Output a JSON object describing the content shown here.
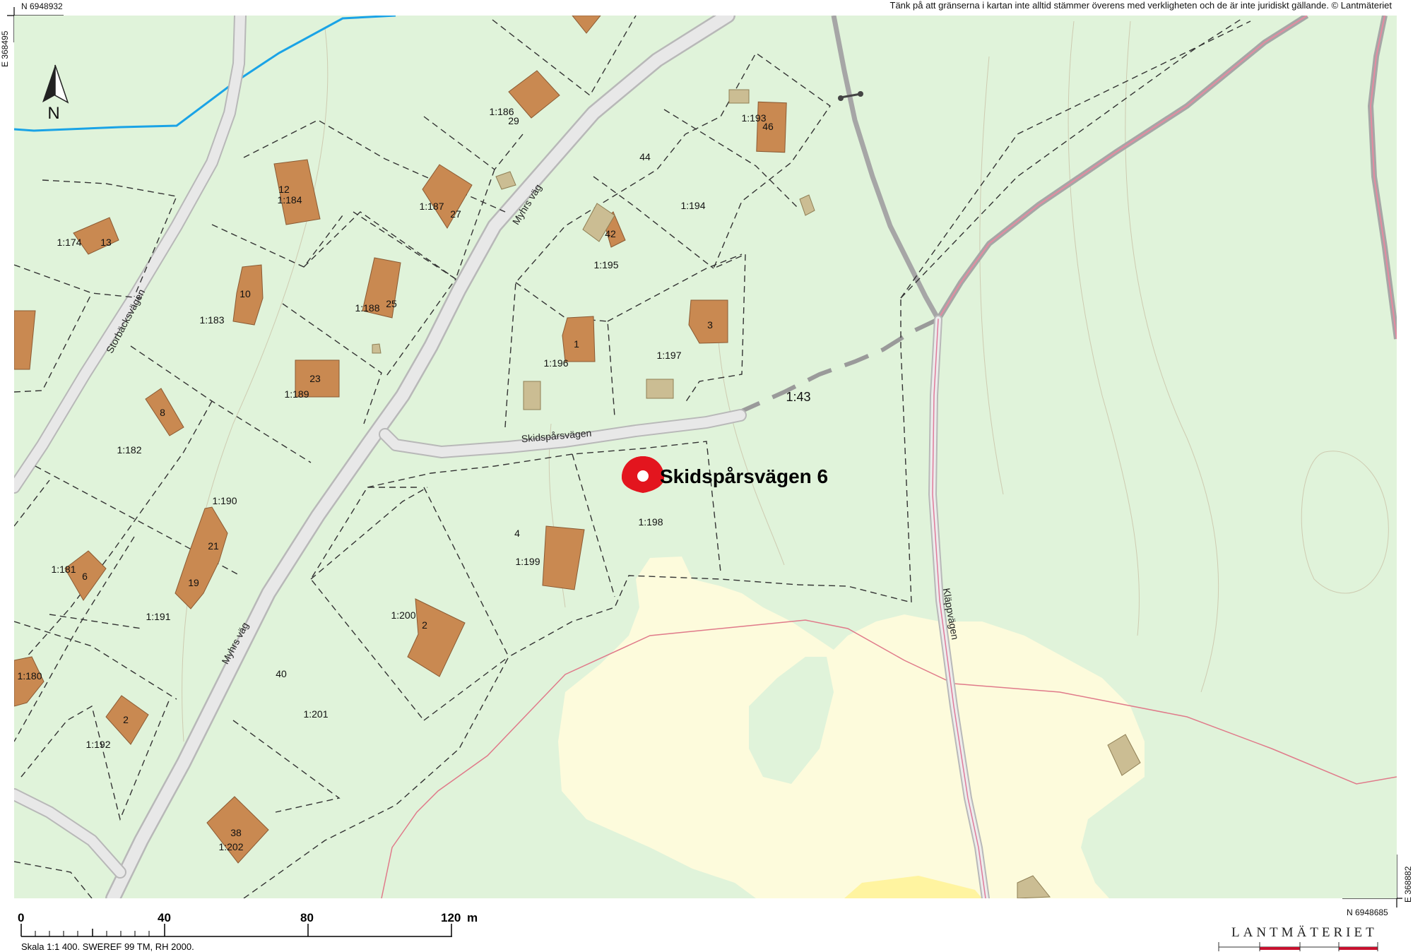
{
  "disclaimer": "Tänk på att gränserna i kartan inte alltid stämmer överens med verkligheten och de är inte juridiskt gällande. © Lantmäteriet",
  "coords": {
    "north_top": "N 6948932",
    "east_left": "E 368495",
    "north_bottom": "N 6948685",
    "east_right": "E 368882"
  },
  "marker": {
    "label": "Skidspårsvägen 6",
    "color": "#e3151e"
  },
  "north_arrow": "N",
  "roads": {
    "storback": "Storbäcksvägen",
    "myhrs_upper": "Myhrs väg",
    "myhrs_lower": "Myhrs väg",
    "skidspar": "Skidspårsvägen",
    "klapp": "Kläppvägen"
  },
  "parcel_labels": [
    "1:186",
    "29",
    "1:193",
    "46",
    "44",
    "12",
    "1:184",
    "1:187",
    "27",
    "1:194",
    "1:174",
    "13",
    "42",
    "1:195",
    "10",
    "1:183",
    "1:188",
    "25",
    "3",
    "1",
    "1:197",
    "1:196",
    "23",
    "1:189",
    "8",
    "1:43",
    "1:182",
    "1:198",
    "1:190",
    "4",
    "21",
    "1:199",
    "1:181",
    "6",
    "19",
    "1:200",
    "2",
    "1:191",
    "1:180",
    "40",
    "2",
    "1:201",
    "1:192",
    "38",
    "1:202"
  ],
  "scale": {
    "ticks": [
      "0",
      "40",
      "80",
      "120"
    ],
    "unit": "m",
    "note": "Skala 1:1 400. SWEREF 99 TM, RH 2000."
  },
  "brand": "LANTMÄTERIET",
  "colors": {
    "land": "#e0f3da",
    "open_land": "#fdfbdc",
    "building": "#c98951",
    "building_outline": "#8a5a33",
    "minor_building": "#cbbd93",
    "road_fill": "#e8e8e8",
    "road_edge": "#b5b5b5",
    "water": "#1aa3e6",
    "boundary": "#e07a8a",
    "parcel_line": "#333333",
    "track": "#999999"
  }
}
